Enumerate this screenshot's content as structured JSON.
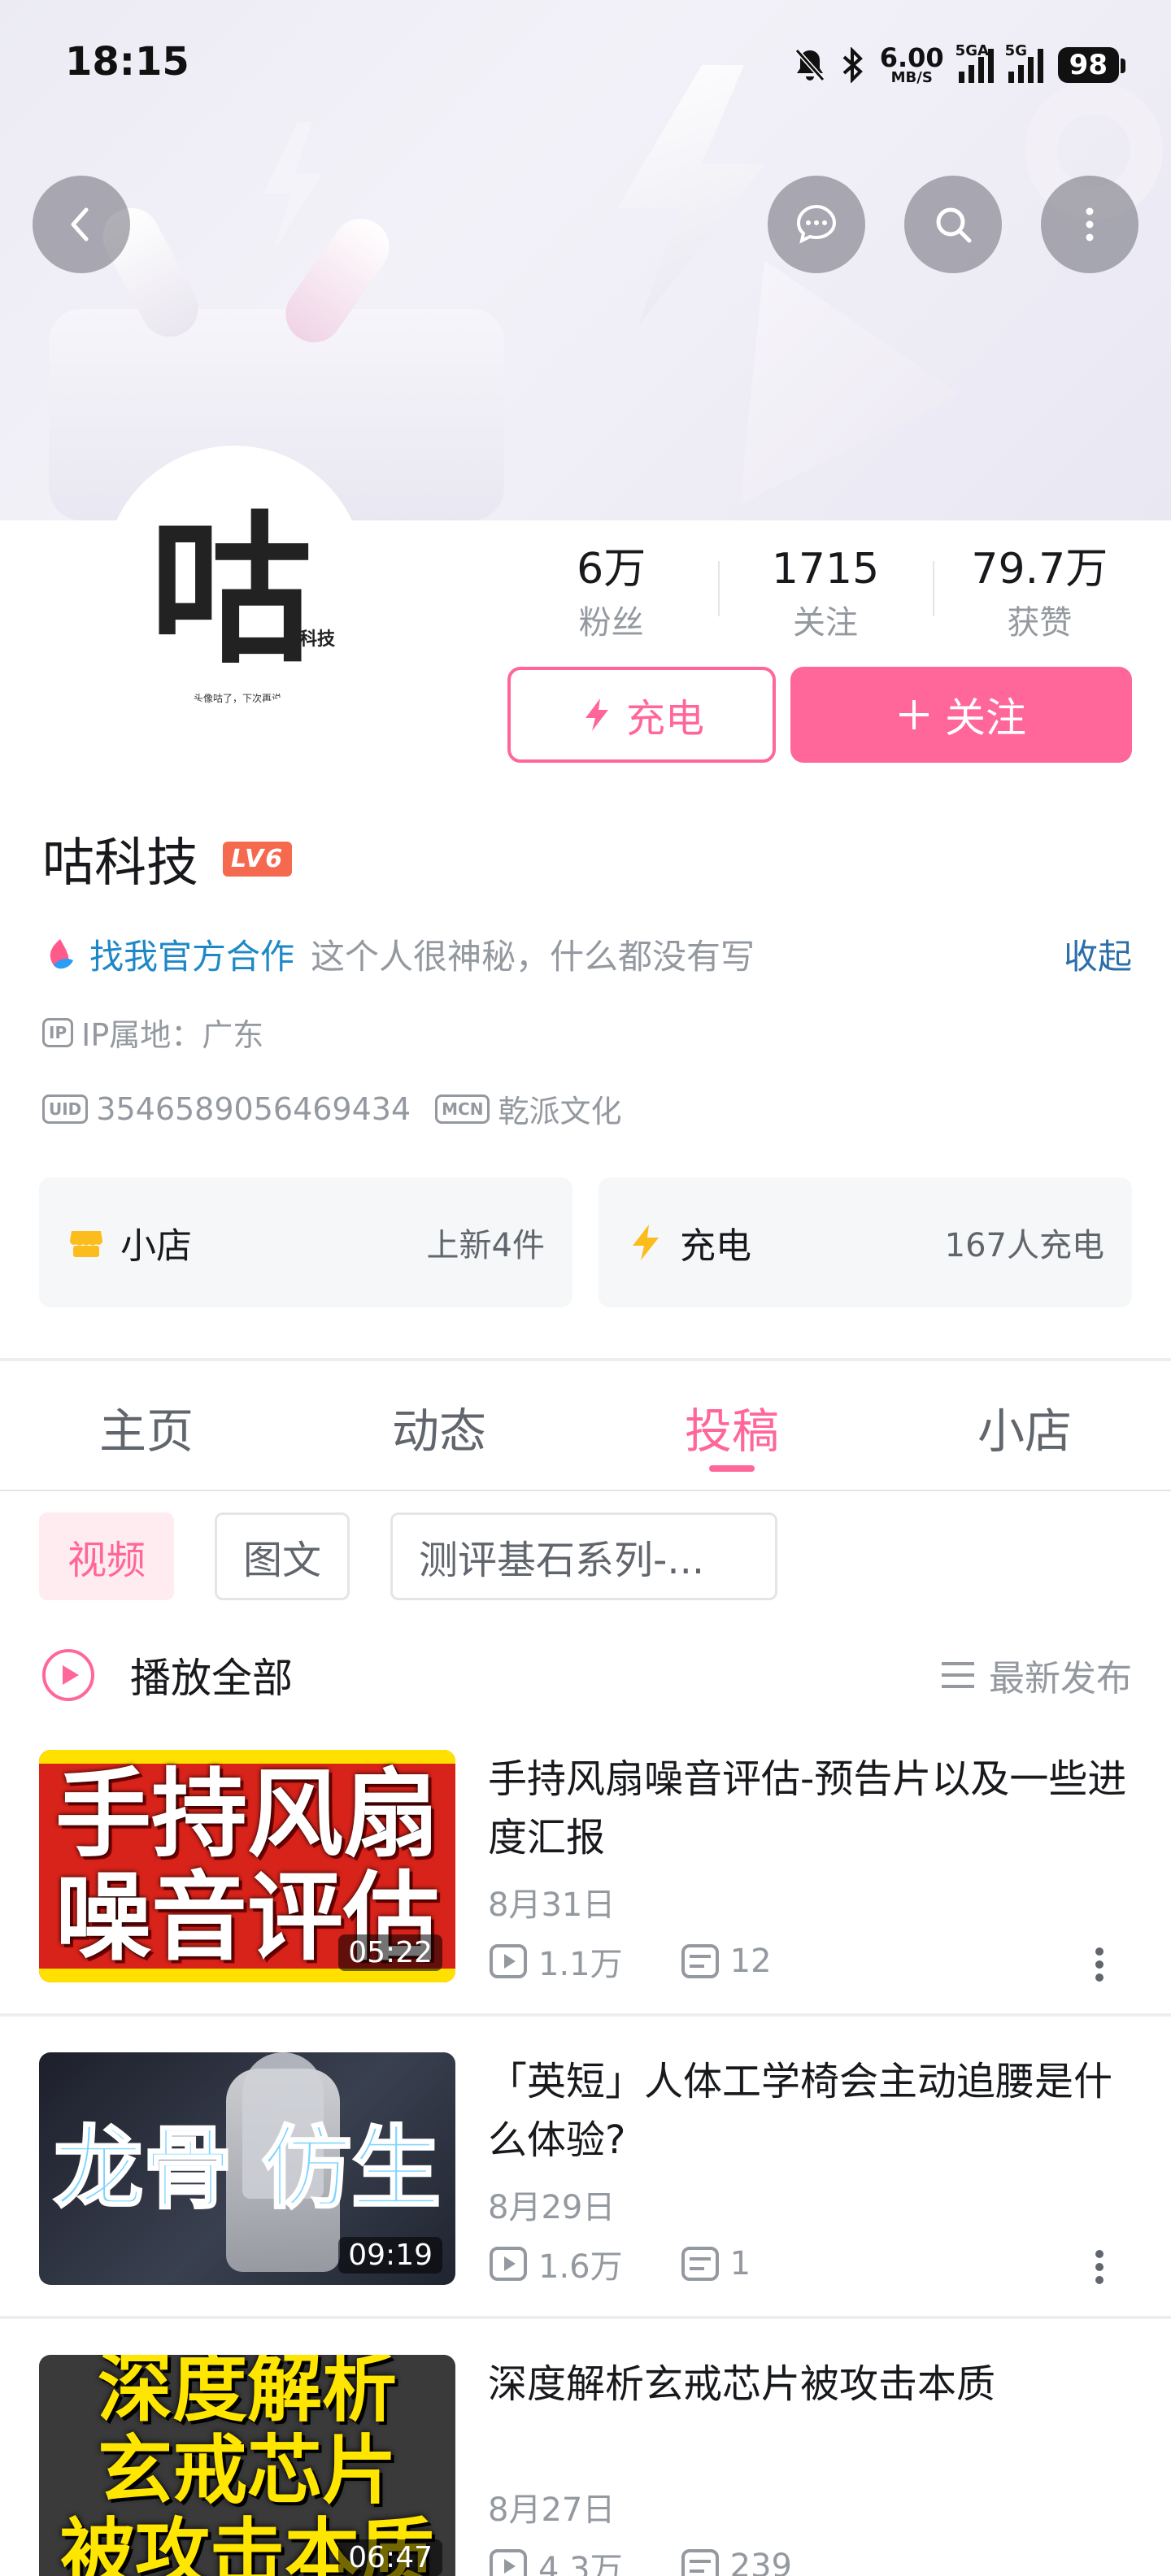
{
  "status_bar": {
    "time": "18:15",
    "speed_value": "6.00",
    "speed_unit": "MB/S",
    "signal1_label": "5GA",
    "signal2_label": "5G",
    "battery": "98"
  },
  "profile": {
    "avatar_logo": "咕",
    "avatar_sub": "科技",
    "avatar_slogan": "头像咕了，下次再说",
    "name": "咕科技",
    "level": "LV6",
    "bio_link": "找我官方合作",
    "bio_text": "这个人很神秘，什么都没有写",
    "bio_toggle": "收起",
    "ip_tag": "IP",
    "ip_location": "IP属地：广东",
    "uid_tag": "UID",
    "uid": "3546589056469434",
    "mcn_tag": "MCN",
    "mcn": "乾派文化"
  },
  "stats": [
    {
      "value": "6万",
      "label": "粉丝"
    },
    {
      "value": "1715",
      "label": "关注"
    },
    {
      "value": "79.7万",
      "label": "获赞"
    }
  ],
  "actions": {
    "charge_label": "充电",
    "follow_label": "关注"
  },
  "cards": {
    "shop_title": "小店",
    "shop_sub": "上新4件",
    "charge_title": "充电",
    "charge_sub": "167人充电"
  },
  "tabs": [
    "主页",
    "动态",
    "投稿",
    "小店"
  ],
  "active_tab": "投稿",
  "filters": [
    "视频",
    "图文",
    "测评基石系列-..."
  ],
  "list_header": {
    "play_all": "播放全部",
    "sort": "最新发布"
  },
  "videos": [
    {
      "thumb_text": [
        "手持风扇",
        "噪音评估"
      ],
      "duration": "05:22",
      "title": "手持风扇噪音评估-预告片以及一些进度汇报",
      "date": "8月31日",
      "views": "1.1万",
      "comments": "12"
    },
    {
      "thumb_text": [
        "龙骨",
        "仿生"
      ],
      "duration": "09:19",
      "title": "「英短」人体工学椅会主动追腰是什么体验?",
      "date": "8月29日",
      "views": "1.6万",
      "comments": "1"
    },
    {
      "thumb_text": [
        "深度解析",
        "玄戒芯片",
        "被攻击本质"
      ],
      "duration": "06:47",
      "title": "深度解析玄戒芯片被攻击本质",
      "date": "8月27日",
      "views": "4.3万",
      "comments": "239"
    }
  ],
  "colors": {
    "accent": "#ff6699",
    "link": "#1e88c7",
    "muted": "#9499a0",
    "level_badge": "#f56a4f"
  }
}
